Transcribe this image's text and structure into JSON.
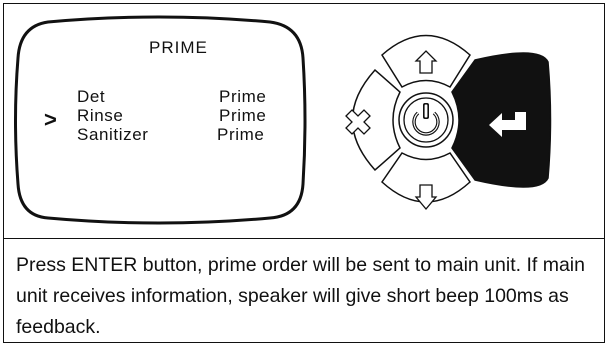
{
  "screen": {
    "title": "PRIME",
    "selector": ">",
    "rows": [
      {
        "name": "Det",
        "action": "Prime"
      },
      {
        "name": "Rinse",
        "action": "Prime"
      },
      {
        "name": "Sanitizer",
        "action": "Prime"
      }
    ]
  },
  "keypad": {
    "up_icon": "up-arrow-icon",
    "down_icon": "down-arrow-icon",
    "cancel_icon": "x-icon",
    "power_icon": "power-icon",
    "enter_icon": "enter-icon",
    "highlighted_button": "enter",
    "highlight_color": "#111111"
  },
  "caption": "Press ENTER button, prime order will be sent to main unit.  If main unit receives information, speaker will give short beep 100ms as feedback."
}
